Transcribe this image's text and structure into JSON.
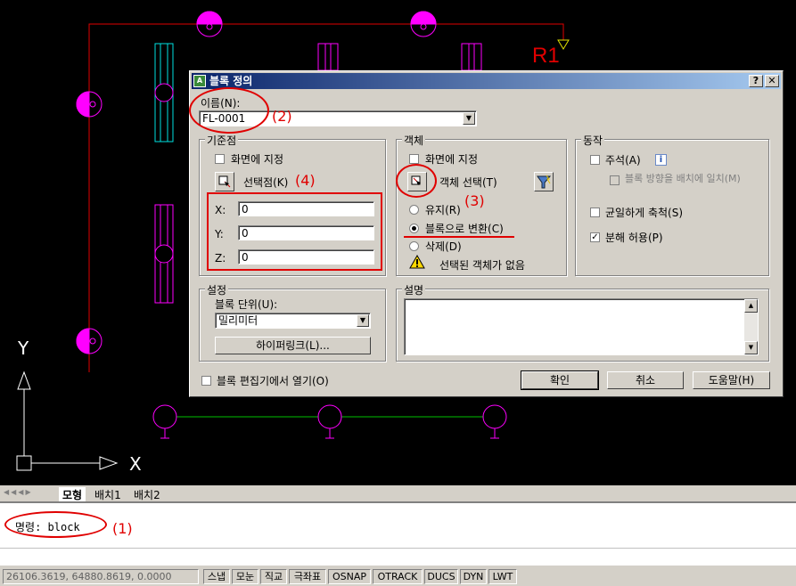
{
  "cad": {
    "r1_label": "R1",
    "y_axis_label": "Y",
    "x_axis_label": "X"
  },
  "dialog": {
    "title": "블록 정의",
    "help_btn": "?",
    "close_btn": "✕",
    "name_label": "이름(N):",
    "name_value": "FL-0001",
    "basepoint": {
      "group": "기준점",
      "on_screen": "화면에 지정",
      "pick_point": "선택점(K)",
      "x_label": "X:",
      "x_value": "0",
      "y_label": "Y:",
      "y_value": "0",
      "z_label": "Z:",
      "z_value": "0"
    },
    "objects": {
      "group": "객체",
      "on_screen": "화면에 지정",
      "select_objects": "객체 선택(T)",
      "retain": "유지(R)",
      "convert": "블록으로 변환(C)",
      "delete": "삭제(D)",
      "warning": "선택된 객체가 없음"
    },
    "behavior": {
      "group": "동작",
      "annotative": "주석(A)",
      "info_icon": "i",
      "match_orientation": "블록 방향을 배치에 일치(M)",
      "scale_uniformly": "균일하게 축척(S)",
      "allow_exploding": "분해 허용(P)"
    },
    "settings": {
      "group": "설정",
      "unit_label": "블록 단위(U):",
      "unit_value": "밀리미터",
      "hyperlink": "하이퍼링크(L)..."
    },
    "description": {
      "group": "설명"
    },
    "open_in_editor": "블록 편집기에서 열기(O)",
    "ok": "확인",
    "cancel": "취소",
    "help": "도움말(H)"
  },
  "annotations": {
    "a1": "(1)",
    "a2": "(2)",
    "a3": "(3)",
    "a4": "(4)"
  },
  "tabs": {
    "model": "모형",
    "layout1": "배치1",
    "layout2": "배치2"
  },
  "command": {
    "text": "명령: block"
  },
  "status": {
    "coords": "26106.3619, 64880.8619, 0.0000",
    "buttons": [
      "스냅",
      "모눈",
      "직교",
      "극좌표",
      "OSNAP",
      "OTRACK",
      "DUCS",
      "DYN",
      "LWT"
    ]
  },
  "colors": {
    "magenta": "#ff00ff",
    "red": "#e00000",
    "cyan": "#00e0e0",
    "green": "#00c000",
    "titlebar": "#0a246a"
  }
}
